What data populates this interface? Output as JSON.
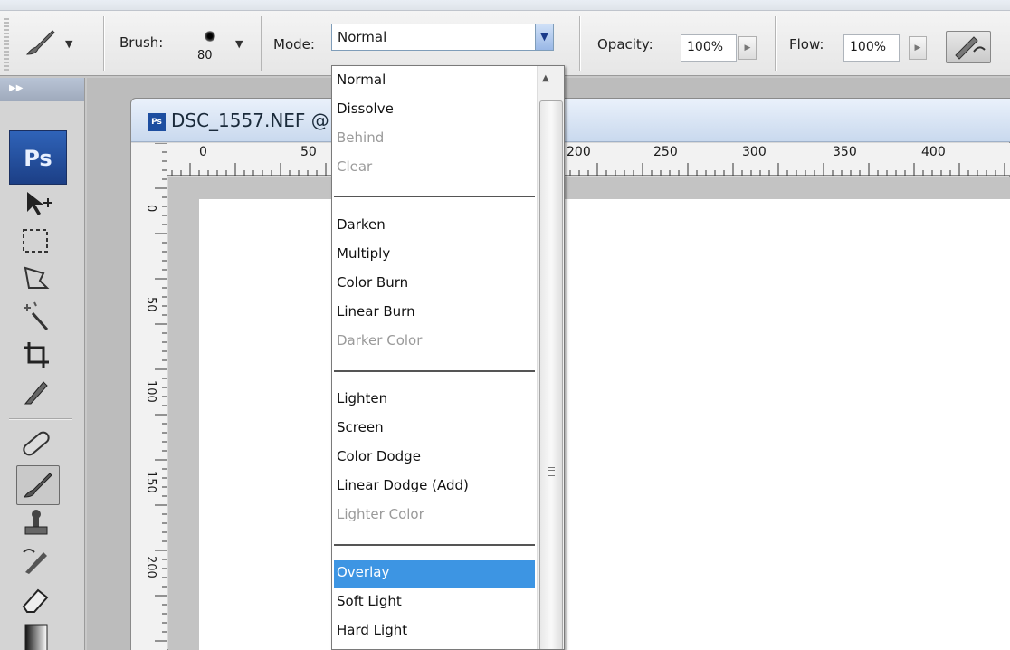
{
  "options_bar": {
    "brush_label": "Brush:",
    "brush_size": "80",
    "mode_label": "Mode:",
    "mode_value": "Normal",
    "opacity_label": "Opacity:",
    "opacity_value": "100%",
    "flow_label": "Flow:",
    "flow_value": "100%",
    "icons": [
      "brush-tool-icon",
      "airbrush-icon"
    ]
  },
  "toolbox": {
    "logo": "Ps",
    "tools": [
      "move-icon",
      "marquee-icon",
      "lasso-icon",
      "magic-wand-icon",
      "crop-icon",
      "slice-icon",
      "healing-brush-icon",
      "brush-icon",
      "clone-stamp-icon",
      "history-brush-icon",
      "eraser-icon",
      "gradient-icon"
    ]
  },
  "document": {
    "title": "DSC_1557.NEF @",
    "file_icon": "Ps",
    "hruler_labels": [
      "0",
      "50",
      "200",
      "250",
      "300",
      "350",
      "400"
    ],
    "vruler_labels": [
      "0",
      "50",
      "100",
      "150",
      "200"
    ]
  },
  "blend_modes": {
    "items": [
      {
        "label": "Normal",
        "disabled": false,
        "selected": false
      },
      {
        "label": "Dissolve",
        "disabled": false,
        "selected": false
      },
      {
        "label": "Behind",
        "disabled": true,
        "selected": false
      },
      {
        "label": "Clear",
        "disabled": true,
        "selected": false
      },
      {
        "label": "Darken",
        "disabled": false,
        "selected": false
      },
      {
        "label": "Multiply",
        "disabled": false,
        "selected": false
      },
      {
        "label": "Color Burn",
        "disabled": false,
        "selected": false
      },
      {
        "label": "Linear Burn",
        "disabled": false,
        "selected": false
      },
      {
        "label": "Darker Color",
        "disabled": true,
        "selected": false
      },
      {
        "label": "Lighten",
        "disabled": false,
        "selected": false
      },
      {
        "label": "Screen",
        "disabled": false,
        "selected": false
      },
      {
        "label": "Color Dodge",
        "disabled": false,
        "selected": false
      },
      {
        "label": "Linear Dodge (Add)",
        "disabled": false,
        "selected": false
      },
      {
        "label": "Lighter Color",
        "disabled": true,
        "selected": false
      },
      {
        "label": "Overlay",
        "disabled": false,
        "selected": true
      },
      {
        "label": "Soft Light",
        "disabled": false,
        "selected": false
      },
      {
        "label": "Hard Light",
        "disabled": false,
        "selected": false
      }
    ]
  },
  "colors": {
    "selection": "#3d95e3",
    "disabled_text": "#9a9a9a",
    "ps_logo": "#2f63b8"
  }
}
